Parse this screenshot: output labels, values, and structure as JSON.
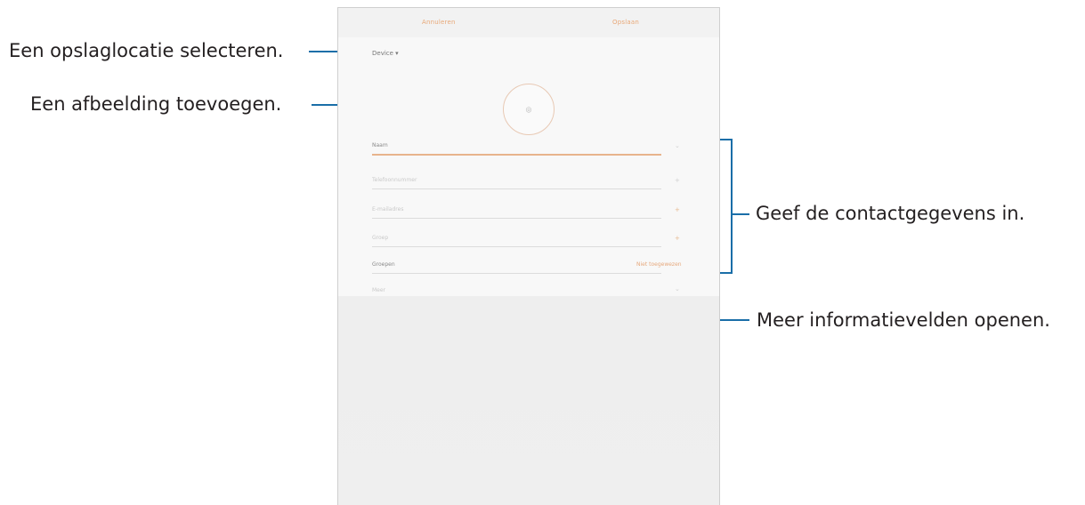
{
  "callouts": {
    "storage": "Een opslaglocatie selecteren.",
    "image": "Een afbeelding toevoegen.",
    "contact": "Geef de contactgegevens in.",
    "more": "Meer informatievelden openen."
  },
  "app": {
    "cancel_label": "Annuleren",
    "save_label": "Opslaan",
    "storage_label": "Device ▾",
    "photo_glyph": "◎",
    "fields": {
      "name": "Naam",
      "phone": "Telefoonnummer",
      "email": "E-mailadres",
      "group_item": "Groep",
      "groups": "Groepen",
      "groups_value": "Niet toegewezen",
      "more": "Meer"
    },
    "icons": {
      "name_expand": "⌄",
      "phone_add": "+",
      "email_add": "+",
      "more_expand": "⌄"
    }
  },
  "colors": {
    "accent": "#e8a878",
    "callout_line": "#1a6ea8"
  }
}
